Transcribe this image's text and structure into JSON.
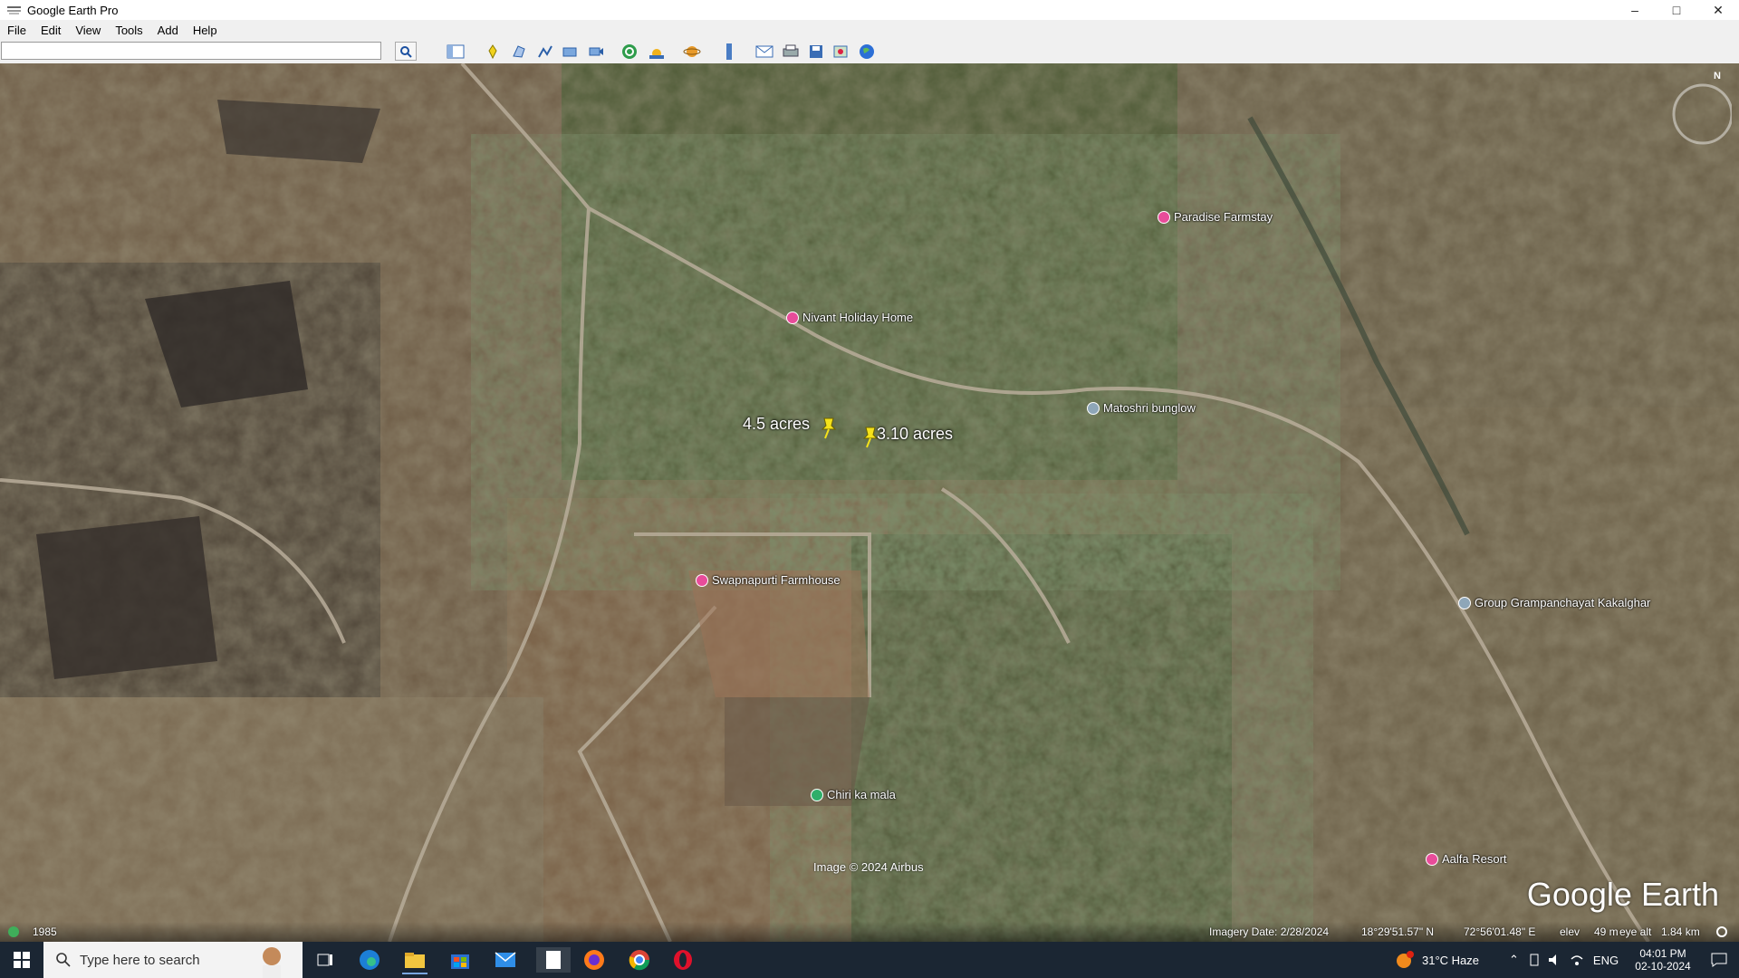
{
  "window": {
    "title": "Google Earth Pro"
  },
  "menu": {
    "items": [
      "File",
      "Edit",
      "View",
      "Tools",
      "Add",
      "Help"
    ]
  },
  "toolbar": {
    "search_value": "",
    "icons": [
      "sidebar-toggle-icon",
      "placemark-icon",
      "polygon-icon",
      "path-icon",
      "image-overlay-icon",
      "record-tour-icon",
      "historical-imagery-icon",
      "sunlight-icon",
      "planets-icon",
      "ruler-icon",
      "email-icon",
      "print-icon",
      "save-image-icon",
      "view-in-maps-icon",
      "earth-icon"
    ]
  },
  "map": {
    "places": [
      {
        "name": "Paradise Farmstay",
        "kind": "lodging"
      },
      {
        "name": "Nivant Holiday Home",
        "kind": "lodging"
      },
      {
        "name": "Matoshri bunglow",
        "kind": "place"
      },
      {
        "name": "Swapnapurti Farmhouse",
        "kind": "lodging"
      },
      {
        "name": "Group Grampanchayat Kakalghar",
        "kind": "place"
      },
      {
        "name": "Chiri ka mala",
        "kind": "park"
      },
      {
        "name": "Aalfa Resort",
        "kind": "lodging"
      }
    ],
    "pins": [
      {
        "label": "4.5 acres"
      },
      {
        "label": "3.10 acres"
      }
    ],
    "copyright": "Image © 2024 Airbus",
    "logo": "Google Earth",
    "compass_label": "N"
  },
  "status": {
    "year": "1985",
    "imagery_date": "Imagery Date: 2/28/2024",
    "lat": "18°29'51.57\" N",
    "lon": "72°56'01.48\" E",
    "elev_label": "elev",
    "elev_value": "49 m",
    "eye_alt_label": "eye alt",
    "eye_alt_value": "1.84 km"
  },
  "taskbar": {
    "search_placeholder": "Type here to search",
    "weather": "31°C  Haze",
    "language": "ENG",
    "time": "04:01 PM",
    "date": "02-10-2024"
  },
  "colors": {
    "lodging": "#e84c9a",
    "place": "#8ea6b8",
    "park": "#2fae6a",
    "pin": "#f5e21a"
  }
}
